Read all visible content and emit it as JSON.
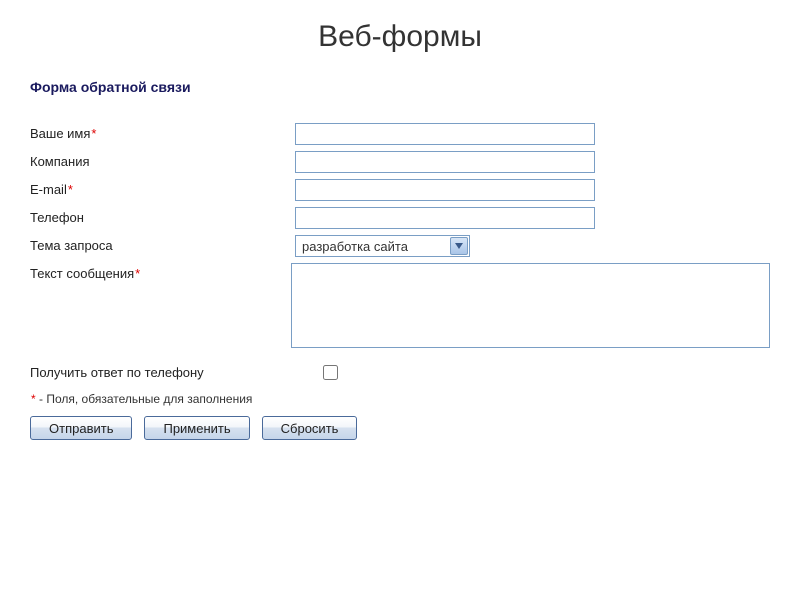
{
  "page": {
    "title": "Веб-формы"
  },
  "form": {
    "title": "Форма обратной связи",
    "fields": {
      "name": {
        "label": "Ваше имя",
        "required": true,
        "value": ""
      },
      "company": {
        "label": "Компания",
        "required": false,
        "value": ""
      },
      "email": {
        "label": "E-mail",
        "required": true,
        "value": ""
      },
      "phone": {
        "label": "Телефон",
        "required": false,
        "value": ""
      },
      "topic": {
        "label": "Тема запроса",
        "required": false,
        "selected": "разработка сайта"
      },
      "message": {
        "label": "Текст сообщения",
        "required": true,
        "value": ""
      },
      "phone_reply": {
        "label": "Получить ответ по телефону",
        "checked": false
      }
    },
    "required_note_prefix": "*",
    "required_note_text": " - Поля, обязательные для заполнения",
    "buttons": {
      "submit": "Отправить",
      "apply": "Применить",
      "reset": "Сбросить"
    }
  }
}
